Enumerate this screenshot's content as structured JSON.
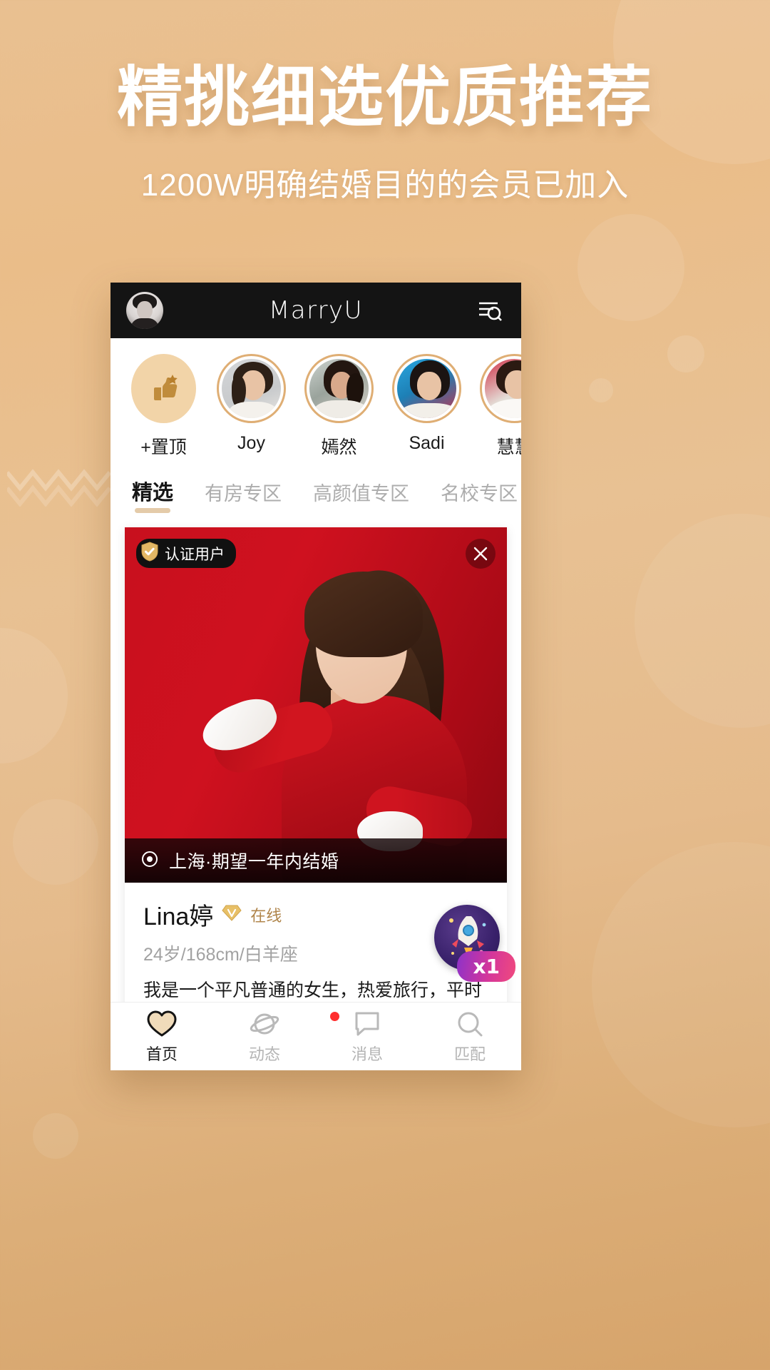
{
  "promo": {
    "headline": "精挑细选优质推荐",
    "subheadline": "1200W明确结婚目的的会员已加入",
    "bg_color": "#e8bd8c"
  },
  "app": {
    "title": "MarryU",
    "header": {
      "avatar_name": "my-avatar",
      "search_icon": "search-menu-icon"
    },
    "stories": [
      {
        "label": "+置顶",
        "type": "pin",
        "icon": "thumbs-up-star-icon"
      },
      {
        "label": "Joy",
        "type": "photo",
        "art": "p-joy"
      },
      {
        "label": "嫣然",
        "type": "photo",
        "art": "p-yan"
      },
      {
        "label": "Sadi",
        "type": "photo",
        "art": "p-sadi"
      },
      {
        "label": "慧慧",
        "type": "photo",
        "art": "p-hui"
      }
    ],
    "tabs": [
      {
        "label": "精选",
        "active": true
      },
      {
        "label": "有房专区",
        "active": false
      },
      {
        "label": "高颜值专区",
        "active": false
      },
      {
        "label": "名校专区",
        "active": false
      }
    ],
    "card": {
      "verified_label": "认证用户",
      "verified_icon": "shield-check-icon",
      "close_icon": "close-icon",
      "location_icon": "location-target-icon",
      "location": "上海·期望一年内结婚",
      "name": "Lina婷",
      "vip_icon": "diamond-v-icon",
      "online": "在线",
      "meta": "24岁/168cm/白羊座",
      "desc": "我是一个平凡普通的女生，热爱旅行，平时也喜欢和朋友们一起运动，也许能够在这里找到对的人和我",
      "accent_color": "#b0854b"
    },
    "rocket": {
      "label": "x1",
      "icon": "rocket-icon"
    },
    "nav": [
      {
        "label": "首页",
        "icon": "heart-icon",
        "active": true,
        "dot": false
      },
      {
        "label": "动态",
        "icon": "planet-icon",
        "active": false,
        "dot": false
      },
      {
        "label": "消息",
        "icon": "chat-bubble-icon",
        "active": false,
        "dot": true
      },
      {
        "label": "匹配",
        "icon": "search-circle-icon",
        "active": false,
        "dot": false
      }
    ]
  }
}
